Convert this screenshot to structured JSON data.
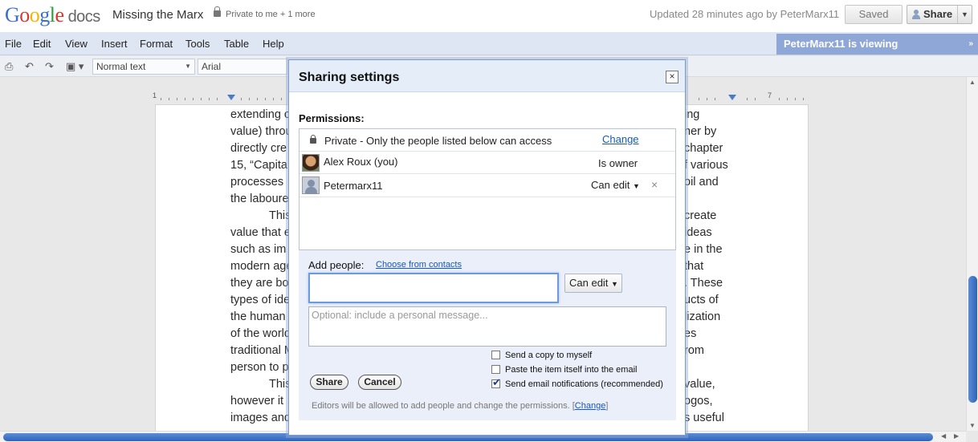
{
  "header": {
    "logo_google": "Google",
    "logo_docs": "docs",
    "doc_title": "Missing the Marx",
    "privacy": "Private to me + 1 more",
    "updated": "Updated 28 minutes ago by PeterMarx11",
    "saved_label": "Saved",
    "share_label": "Share"
  },
  "menu": [
    "File",
    "Edit",
    "View",
    "Insert",
    "Format",
    "Tools",
    "Table",
    "Help"
  ],
  "viewing": "PeterMarx11 is viewing",
  "toolbar": {
    "style_select": "Normal text",
    "font_select": "Arial"
  },
  "ruler": {
    "num1": "1",
    "num7": "7"
  },
  "document": {
    "left_lines": [
      "extending c",
      "value) throu",
      "directly cre",
      "15, “Capita",
      "processes",
      "the laboure",
      "This",
      "value that e",
      "such as im",
      "modern age",
      "they are bo",
      "types of ide",
      "the human",
      "of the world",
      "traditional M",
      "person to p",
      "This",
      "however it",
      "images and"
    ],
    "right_lines": [
      "ing",
      "ner by",
      "chapter",
      "f various",
      "oil and",
      "",
      "create",
      "ideas",
      "e in the",
      "that",
      ". These",
      "ucts of",
      "lization",
      "es",
      "rom",
      "",
      "value,",
      "ogos,",
      "s useful"
    ]
  },
  "dialog": {
    "title": "Sharing settings",
    "close": "×",
    "permissions_label": "Permissions:",
    "private_text": "Private - Only the people listed below can access",
    "change_link": "Change",
    "owner_name": "Alex Roux (you)",
    "owner_role": "Is owner",
    "editor_name": "Petermarx11",
    "editor_role": "Can edit",
    "remove": "×",
    "add_people_label": "Add people:",
    "choose_contacts": "Choose from contacts",
    "people_input_value": "",
    "new_perm": "Can edit",
    "message_placeholder": "Optional: include a personal message...",
    "checkbox_copy": "Send a copy to myself",
    "checkbox_paste": "Paste the item itself into the email",
    "checkbox_notify": "Send email notifications (recommended)",
    "share_button": "Share",
    "cancel_button": "Cancel",
    "note_text": "Editors will be allowed to add people and change the permissions.",
    "note_change": "Change"
  },
  "icons": {
    "print": "printer-icon",
    "undo": "undo-icon",
    "redo": "redo-icon",
    "paint": "paint-format-icon"
  },
  "colors": {
    "accent": "#8ea7d6",
    "link": "#1558c0",
    "menubar": "#dfe6f3"
  }
}
